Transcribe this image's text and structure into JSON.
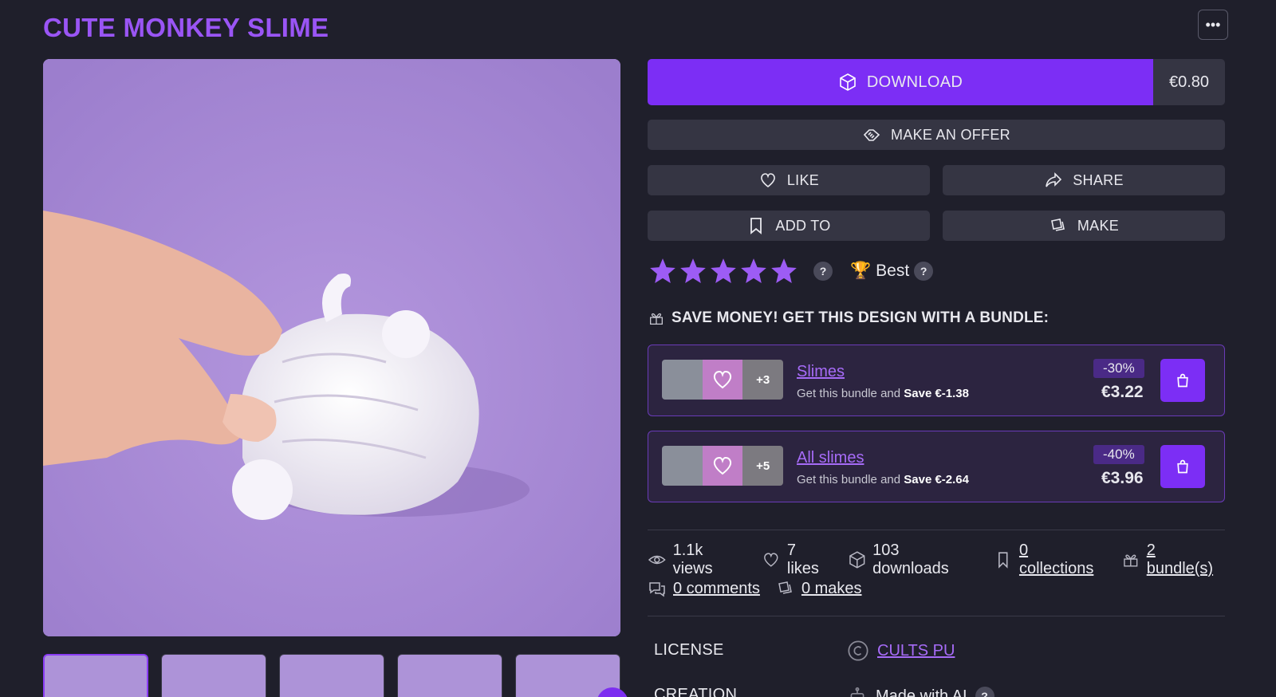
{
  "page": {
    "title": "CUTE MONKEY SLIME",
    "more_icon": "ellipsis-icon"
  },
  "actions": {
    "download_label": "DOWNLOAD",
    "price": "€0.80",
    "offer_label": "MAKE AN OFFER",
    "like_label": "LIKE",
    "share_label": "SHARE",
    "add_to_label": "ADD TO",
    "make_label": "MAKE"
  },
  "rating": {
    "stars": 5,
    "max": 5,
    "help": "?",
    "badge_label": "Best",
    "badge_help": "?"
  },
  "bundles": {
    "heading": "SAVE MONEY! GET THIS DESIGN WITH A BUNDLE:",
    "items": [
      {
        "name": "Slimes",
        "more_count": "+3",
        "desc_prefix": "Get this bundle and",
        "save_text": "Save €-1.38",
        "discount": "-30%",
        "price": "€3.22"
      },
      {
        "name": "All slimes",
        "more_count": "+5",
        "desc_prefix": "Get this bundle and",
        "save_text": "Save €-2.64",
        "discount": "-40%",
        "price": "€3.96"
      }
    ]
  },
  "stats": {
    "views": "1.1k views",
    "likes": "7 likes",
    "downloads": "103 downloads",
    "collections": "0 collections",
    "bundles": "2 bundle(s)",
    "comments": "0 comments",
    "makes": "0 makes"
  },
  "meta": {
    "license_label": "LICENSE",
    "license_value": "CULTS PU",
    "creation_label": "CREATION",
    "creation_value": "Made with AI",
    "creation_help": "?"
  },
  "colors": {
    "accent": "#7c2ef5",
    "title": "#9a55f5",
    "background": "#1f1f2b",
    "star": "#9d5cf5"
  }
}
